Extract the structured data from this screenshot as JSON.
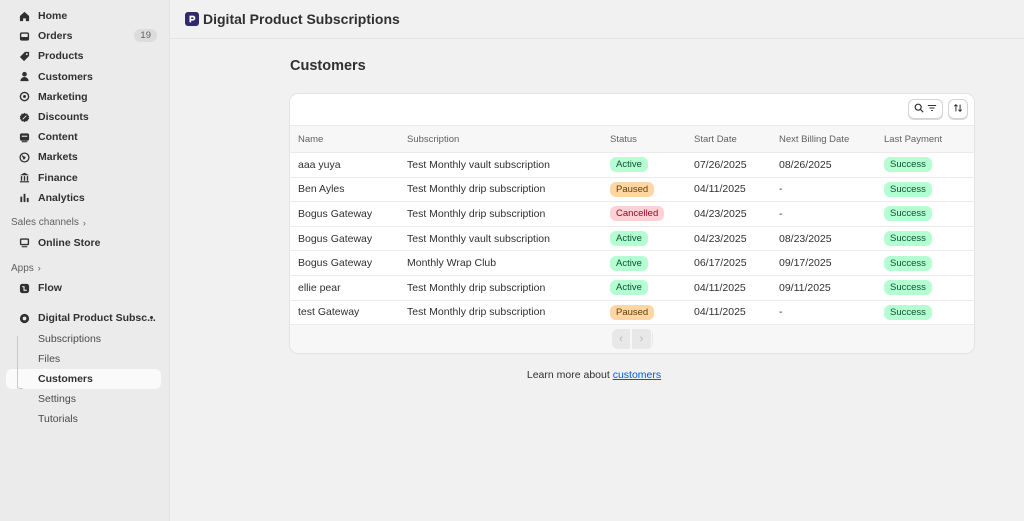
{
  "sidebar": {
    "nav": [
      {
        "label": "Home",
        "icon": "home-icon"
      },
      {
        "label": "Orders",
        "icon": "inbox-icon",
        "badge": "19"
      },
      {
        "label": "Products",
        "icon": "tag-icon"
      },
      {
        "label": "Customers",
        "icon": "person-icon"
      },
      {
        "label": "Marketing",
        "icon": "target-icon"
      },
      {
        "label": "Discounts",
        "icon": "discount-icon"
      },
      {
        "label": "Content",
        "icon": "content-icon"
      },
      {
        "label": "Markets",
        "icon": "globe-icon"
      },
      {
        "label": "Finance",
        "icon": "bank-icon"
      },
      {
        "label": "Analytics",
        "icon": "chart-icon"
      }
    ],
    "sales_channels_label": "Sales channels",
    "online_store": "Online Store",
    "apps_label": "Apps",
    "flow": "Flow",
    "app_name": "Digital Product Subsc...",
    "app_sub": [
      "Subscriptions",
      "Files",
      "Customers",
      "Settings",
      "Tutorials"
    ]
  },
  "header": {
    "title": "Digital Product Subscriptions"
  },
  "main": {
    "title": "Customers",
    "columns": [
      "Name",
      "Subscription",
      "Status",
      "Start Date",
      "Next Billing Date",
      "Last Payment"
    ],
    "rows": [
      {
        "name": "aaa yuya",
        "subscription": "Test Monthly vault subscription",
        "status": "Active",
        "start": "07/26/2025",
        "next": "08/26/2025",
        "payment": "Success"
      },
      {
        "name": "Ben Ayles",
        "subscription": "Test Monthly drip subscription",
        "status": "Paused",
        "start": "04/11/2025",
        "next": "-",
        "payment": "Success"
      },
      {
        "name": "Bogus Gateway",
        "subscription": "Test Monthly drip subscription",
        "status": "Cancelled",
        "start": "04/23/2025",
        "next": "-",
        "payment": "Success"
      },
      {
        "name": "Bogus Gateway",
        "subscription": "Test Monthly vault subscription",
        "status": "Active",
        "start": "04/23/2025",
        "next": "08/23/2025",
        "payment": "Success"
      },
      {
        "name": "Bogus Gateway",
        "subscription": "Monthly Wrap Club",
        "status": "Active",
        "start": "06/17/2025",
        "next": "09/17/2025",
        "payment": "Success"
      },
      {
        "name": "ellie pear",
        "subscription": "Test Monthly drip subscription",
        "status": "Active",
        "start": "04/11/2025",
        "next": "09/11/2025",
        "payment": "Success"
      },
      {
        "name": "test Gateway",
        "subscription": "Test Monthly drip subscription",
        "status": "Paused",
        "start": "04/11/2025",
        "next": "-",
        "payment": "Success"
      }
    ],
    "learn_prefix": "Learn more about",
    "learn_link": "customers"
  },
  "colors": {
    "active": "#b4fed2",
    "paused": "#ffd6a4",
    "cancelled": "#fed1d7",
    "link": "#005bd3"
  }
}
